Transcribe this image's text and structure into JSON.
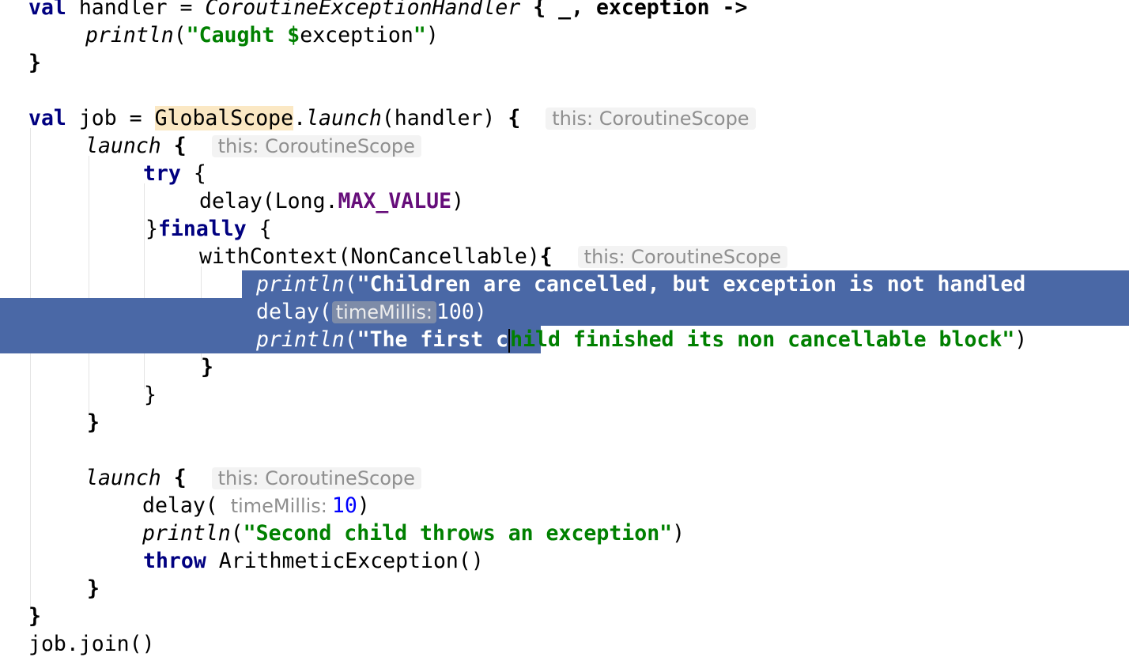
{
  "editor": {
    "kw_val": "val",
    "kw_try": "try",
    "kw_finally": "finally",
    "kw_throw": "throw",
    "lines": {
      "l1": {
        "name_handler": "handler = ",
        "type_handler": "CoroutineExceptionHandler",
        "lambda": " { _, exception ->"
      },
      "l2": {
        "fn": "println",
        "open": "(",
        "str_caught": "\"Caught $",
        "var_exception": "exception",
        "close_quote": "\"",
        "close": ")"
      },
      "l3": {
        "brace": "}"
      },
      "l5": {
        "job_assign": "job = ",
        "global_scope": "GlobalScope",
        "dot": ".",
        "launch": "launch",
        "args": "(handler) ",
        "brace": "{",
        "hint": "this: CoroutineScope"
      },
      "l6": {
        "launch": "launch",
        "brace": " {",
        "hint": "this: CoroutineScope"
      },
      "l7": {
        "brace": " {"
      },
      "l8": {
        "delay": "delay(Long.",
        "const": "MAX_VALUE",
        "close": ")"
      },
      "l9": {
        "close": "}",
        "brace": " {"
      },
      "l10": {
        "call": "withContext(NonCancellable)",
        "brace": "{",
        "hint": "this: CoroutineScope"
      },
      "l11": {
        "fn": "println",
        "open": "(",
        "str": "\"Children are cancelled, but exception is not handled"
      },
      "l12": {
        "delay": "delay(",
        "hint": "timeMillis:",
        "value": "100",
        "close": ")"
      },
      "l13": {
        "fn": "println",
        "open": "(",
        "str_selected": "\"The first c",
        "str_rest": "hild finished its non cancellable block\"",
        "close": ")"
      },
      "l14": {
        "brace": "}"
      },
      "l15": {
        "brace": "}"
      },
      "l16": {
        "brace": "}"
      },
      "l18": {
        "launch": "launch",
        "brace": " {",
        "hint": "this: CoroutineScope"
      },
      "l19": {
        "delay": "delay(",
        "hint": "timeMillis:",
        "value": "10",
        "close": ")"
      },
      "l20": {
        "fn": "println",
        "open": "(",
        "str": "\"Second child throws an exception\"",
        "close": ")"
      },
      "l21": {
        "ctor": " ArithmeticException()"
      },
      "l22": {
        "brace": "}"
      },
      "l23": {
        "brace": "}"
      },
      "l24": {
        "call": "job.join()"
      }
    }
  },
  "colors": {
    "keyword": "#000080",
    "string": "#008000",
    "constant": "#660e7a",
    "number": "#0000ff",
    "selection": "#4a68a6",
    "global_scope_highlight": "#fbe8c4",
    "inlay_hint_text": "#8f8f8f"
  }
}
